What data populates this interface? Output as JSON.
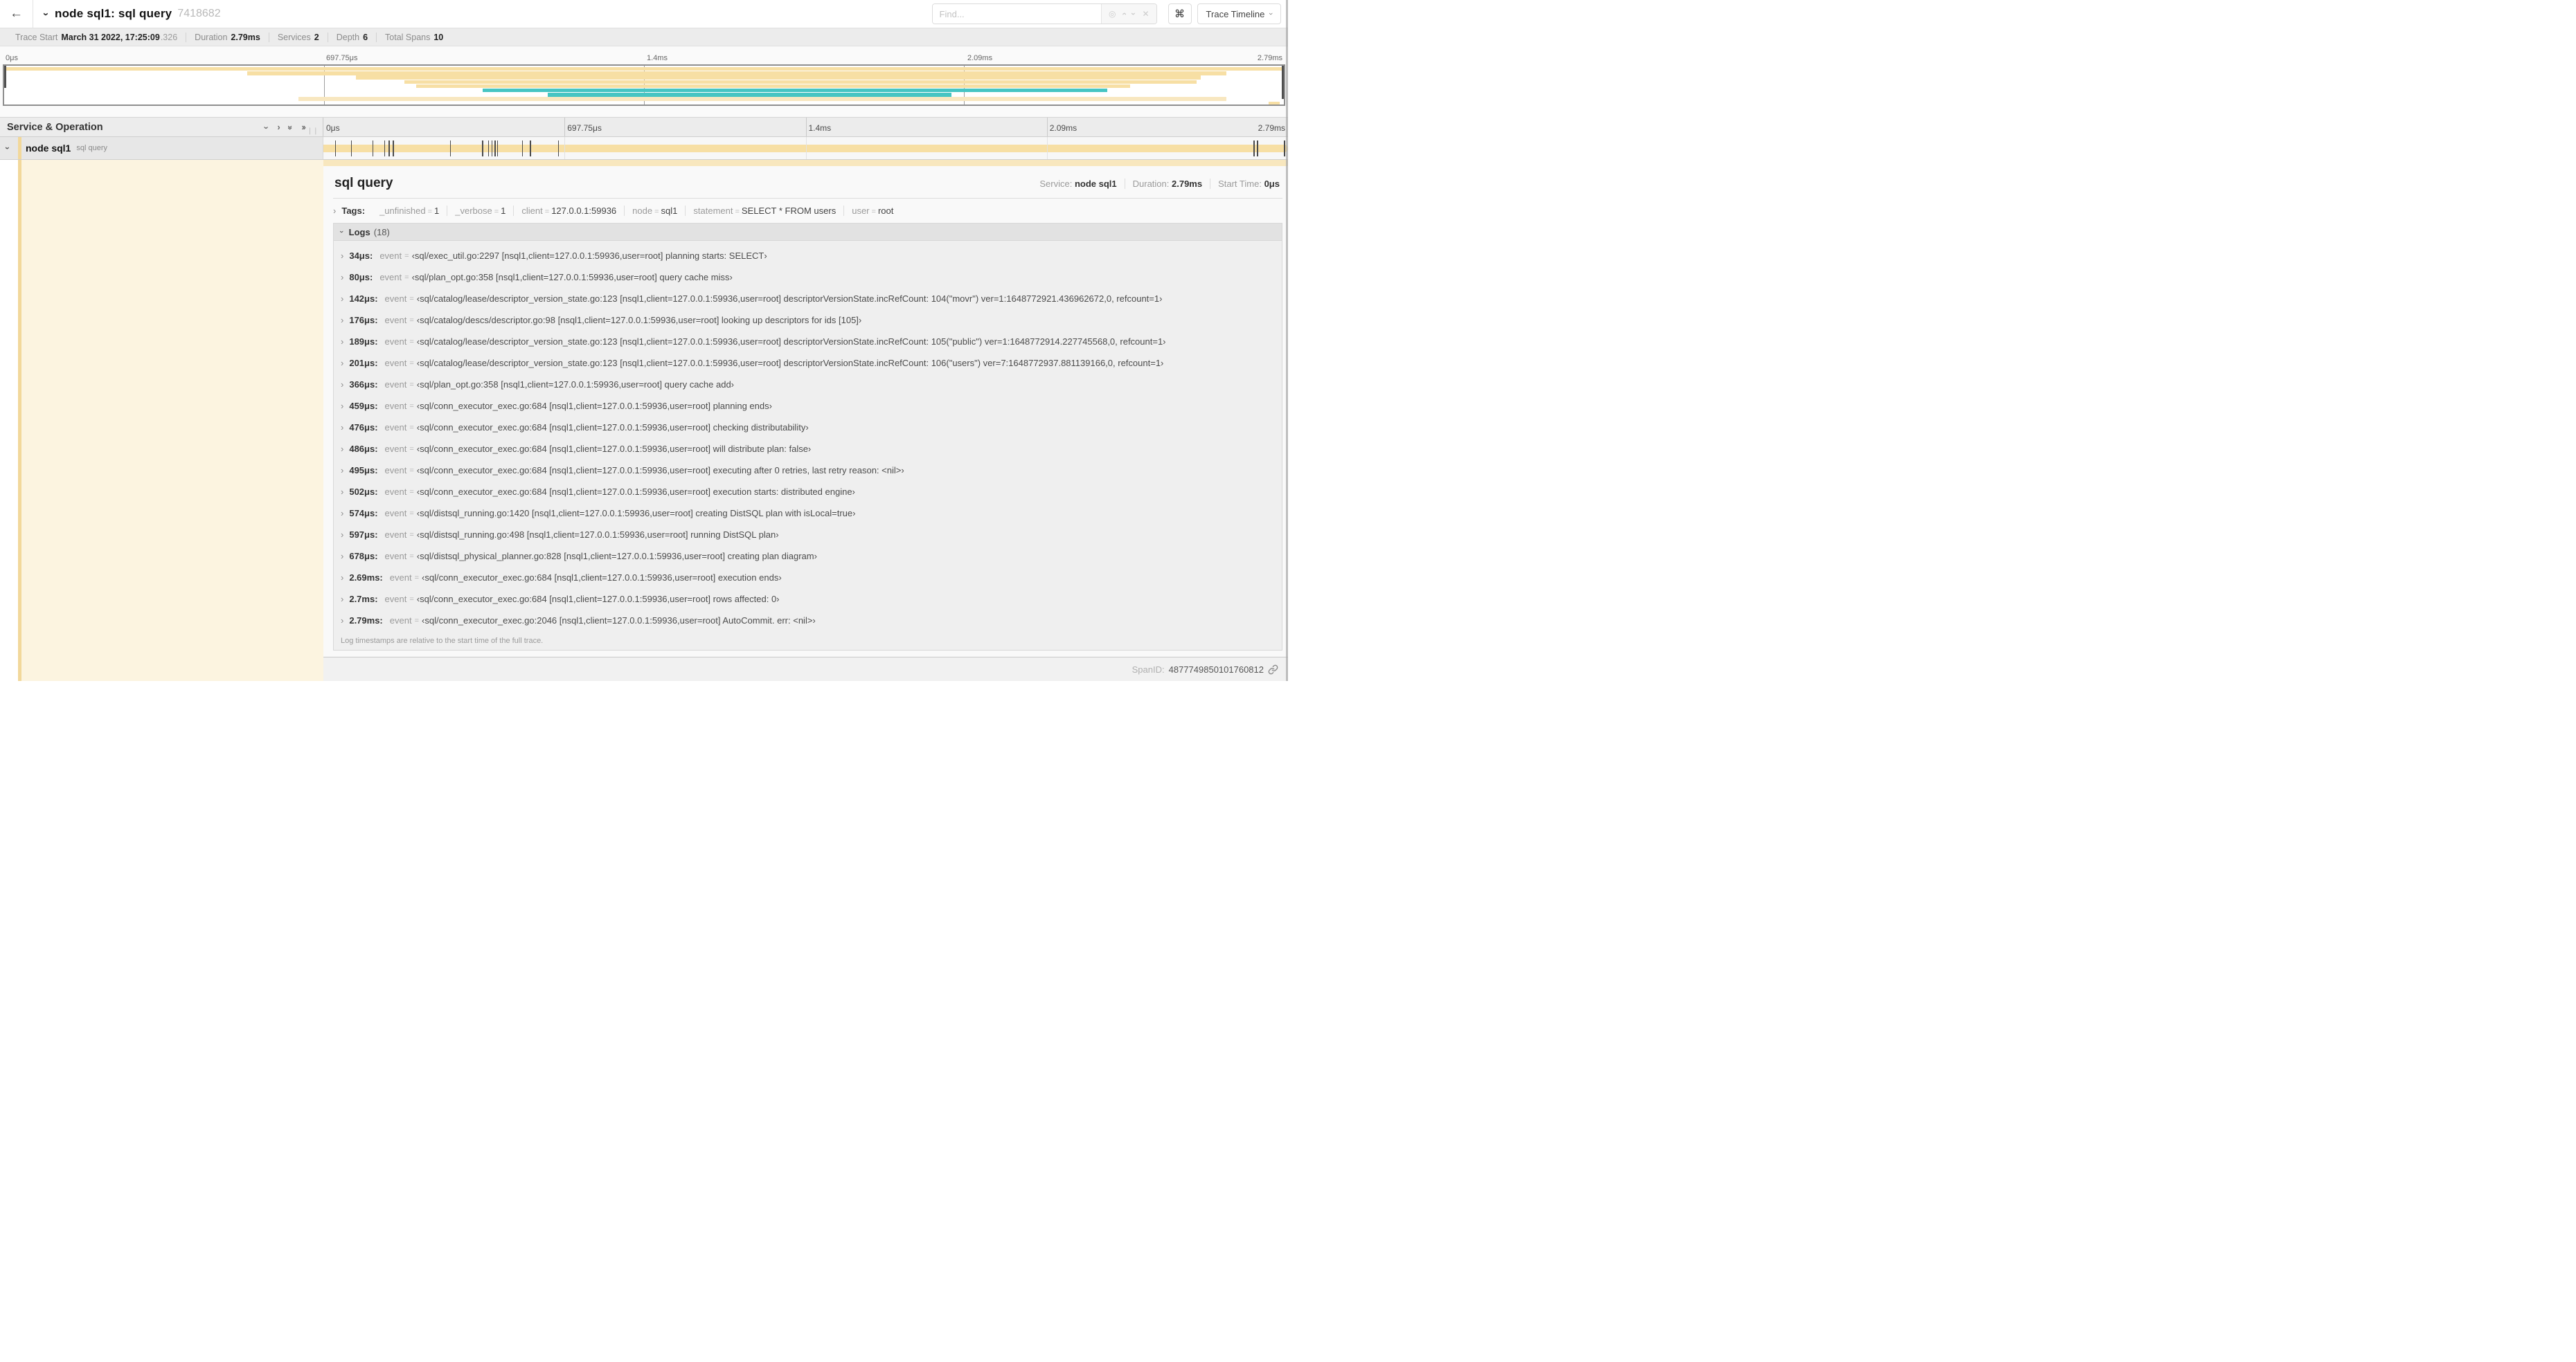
{
  "header": {
    "back_icon": "←",
    "collapse_icon": "›",
    "title": "node sql1: sql query",
    "trace_id": "7418682",
    "find_placeholder": "Find...",
    "shortcut_icon": "⌘",
    "view_selector": "Trace Timeline"
  },
  "stats": {
    "trace_start_label": "Trace Start",
    "trace_start_value": "March 31 2022, 17:25:09",
    "trace_start_fraction": ".326",
    "duration_label": "Duration",
    "duration_value": "2.79ms",
    "services_label": "Services",
    "services_value": "2",
    "depth_label": "Depth",
    "depth_value": "6",
    "total_spans_label": "Total Spans",
    "total_spans_value": "10"
  },
  "timeline": {
    "ticks": [
      "0μs",
      "697.75μs",
      "1.4ms",
      "2.09ms",
      "2.79ms"
    ],
    "duration_us": 2790,
    "colors": {
      "tan": "#F7DFA4",
      "tan_light": "#F8E7C0",
      "teal": "#46C5C3"
    },
    "minimap_spans": [
      {
        "start": 0.0,
        "end": 1.0,
        "color": "tan"
      },
      {
        "start": 0.19,
        "end": 0.955,
        "color": "tan"
      },
      {
        "start": 0.275,
        "end": 0.935,
        "color": "tan"
      },
      {
        "start": 0.313,
        "end": 0.932,
        "color": "tan"
      },
      {
        "start": 0.322,
        "end": 0.88,
        "color": "tan"
      },
      {
        "start": 0.374,
        "end": 0.862,
        "color": "teal"
      },
      {
        "start": 0.425,
        "end": 0.74,
        "color": "teal"
      },
      {
        "start": 0.23,
        "end": 0.955,
        "color": "tan_light"
      },
      {
        "start": 0.988,
        "end": 0.997,
        "color": "tan"
      }
    ],
    "log_marks_us": [
      34,
      80,
      142,
      176,
      189,
      201,
      366,
      459,
      476,
      486,
      495,
      502,
      574,
      597,
      678,
      2690,
      2700,
      2790
    ]
  },
  "columns": {
    "left_header": "Service & Operation"
  },
  "span_row": {
    "service": "node sql1",
    "operation": "sql query"
  },
  "detail": {
    "title": "sql query",
    "service_label": "Service:",
    "service": "node sql1",
    "duration_label": "Duration:",
    "duration": "2.79ms",
    "start_label": "Start Time:",
    "start": "0μs",
    "tags_label": "Tags:",
    "tags": [
      {
        "key": "_unfinished",
        "value": "1"
      },
      {
        "key": "_verbose",
        "value": "1"
      },
      {
        "key": "client",
        "value": "127.0.0.1:59936"
      },
      {
        "key": "node",
        "value": "sql1"
      },
      {
        "key": "statement",
        "value": "SELECT * FROM users"
      },
      {
        "key": "user",
        "value": "root"
      }
    ],
    "logs_label": "Logs",
    "logs_count": "(18)",
    "log_key": "event",
    "logs": [
      {
        "time": "34μs:",
        "value": "‹sql/exec_util.go:2297 [nsql1,client=127.0.0.1:59936,user=root] planning starts: SELECT›"
      },
      {
        "time": "80μs:",
        "value": "‹sql/plan_opt.go:358 [nsql1,client=127.0.0.1:59936,user=root] query cache miss›"
      },
      {
        "time": "142μs:",
        "value": "‹sql/catalog/lease/descriptor_version_state.go:123 [nsql1,client=127.0.0.1:59936,user=root] descriptorVersionState.incRefCount: 104(\"movr\") ver=1:1648772921.436962672,0, refcount=1›"
      },
      {
        "time": "176μs:",
        "value": "‹sql/catalog/descs/descriptor.go:98 [nsql1,client=127.0.0.1:59936,user=root] looking up descriptors for ids [105]›"
      },
      {
        "time": "189μs:",
        "value": "‹sql/catalog/lease/descriptor_version_state.go:123 [nsql1,client=127.0.0.1:59936,user=root] descriptorVersionState.incRefCount: 105(\"public\") ver=1:1648772914.227745568,0, refcount=1›"
      },
      {
        "time": "201μs:",
        "value": "‹sql/catalog/lease/descriptor_version_state.go:123 [nsql1,client=127.0.0.1:59936,user=root] descriptorVersionState.incRefCount: 106(\"users\") ver=7:1648772937.881139166,0, refcount=1›"
      },
      {
        "time": "366μs:",
        "value": "‹sql/plan_opt.go:358 [nsql1,client=127.0.0.1:59936,user=root] query cache add›"
      },
      {
        "time": "459μs:",
        "value": "‹sql/conn_executor_exec.go:684 [nsql1,client=127.0.0.1:59936,user=root] planning ends›"
      },
      {
        "time": "476μs:",
        "value": "‹sql/conn_executor_exec.go:684 [nsql1,client=127.0.0.1:59936,user=root] checking distributability›"
      },
      {
        "time": "486μs:",
        "value": "‹sql/conn_executor_exec.go:684 [nsql1,client=127.0.0.1:59936,user=root] will distribute plan: false›"
      },
      {
        "time": "495μs:",
        "value": "‹sql/conn_executor_exec.go:684 [nsql1,client=127.0.0.1:59936,user=root] executing after 0 retries, last retry reason: <nil>›"
      },
      {
        "time": "502μs:",
        "value": "‹sql/conn_executor_exec.go:684 [nsql1,client=127.0.0.1:59936,user=root] execution starts: distributed engine›"
      },
      {
        "time": "574μs:",
        "value": "‹sql/distsql_running.go:1420 [nsql1,client=127.0.0.1:59936,user=root] creating DistSQL plan with isLocal=true›"
      },
      {
        "time": "597μs:",
        "value": "‹sql/distsql_running.go:498 [nsql1,client=127.0.0.1:59936,user=root] running DistSQL plan›"
      },
      {
        "time": "678μs:",
        "value": "‹sql/distsql_physical_planner.go:828 [nsql1,client=127.0.0.1:59936,user=root] creating plan diagram›"
      },
      {
        "time": "2.69ms:",
        "value": "‹sql/conn_executor_exec.go:684 [nsql1,client=127.0.0.1:59936,user=root] execution ends›"
      },
      {
        "time": "2.7ms:",
        "value": "‹sql/conn_executor_exec.go:684 [nsql1,client=127.0.0.1:59936,user=root] rows affected: 0›"
      },
      {
        "time": "2.79ms:",
        "value": "‹sql/conn_executor_exec.go:2046 [nsql1,client=127.0.0.1:59936,user=root] AutoCommit. err: <nil>›"
      }
    ],
    "footer": "Log timestamps are relative to the start time of the full trace.",
    "span_id_label": "SpanID:",
    "span_id": "4877749850101760812"
  }
}
